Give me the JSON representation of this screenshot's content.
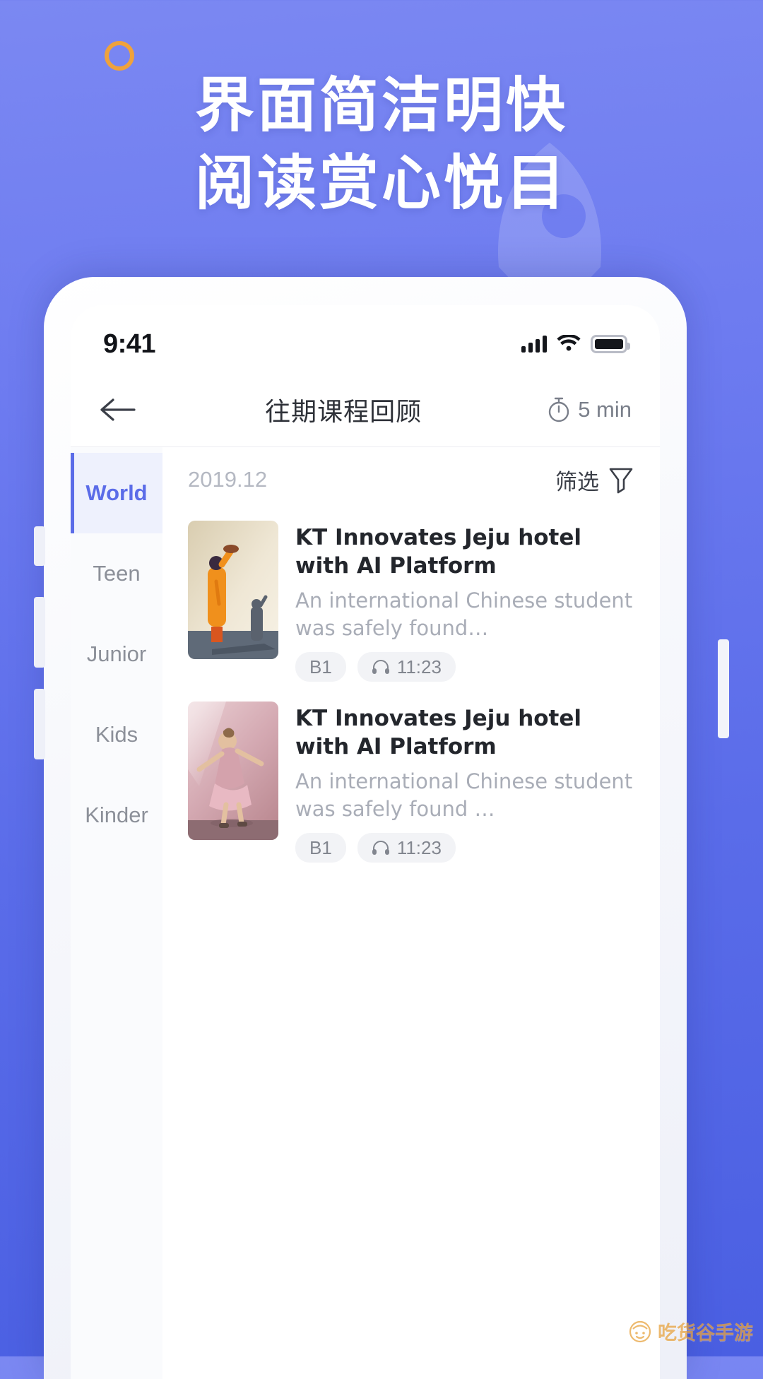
{
  "promo": {
    "headline_line1": "界面简洁明快",
    "headline_line2": "阅读赏心悦目",
    "ring_color": "#efa23c",
    "bg_top": "#7b88f2",
    "bg_bottom": "#4a5fe2"
  },
  "statusbar": {
    "time": "9:41",
    "signal_icon": "cellular-signal-icon",
    "wifi_icon": "wifi-icon",
    "battery_icon": "battery-full-icon"
  },
  "navbar": {
    "back_icon": "back-arrow-icon",
    "title": "往期课程回顾",
    "timer_icon": "stopwatch-icon",
    "duration": "5 min"
  },
  "sidebar": {
    "items": [
      {
        "label": "World",
        "active": true
      },
      {
        "label": "Teen",
        "active": false
      },
      {
        "label": "Junior",
        "active": false
      },
      {
        "label": "Kids",
        "active": false
      },
      {
        "label": "Kinder",
        "active": false
      }
    ],
    "active_color": "#5b6ce8"
  },
  "filter": {
    "date": "2019.12",
    "label": "筛选",
    "icon": "funnel-filter-icon"
  },
  "articles": [
    {
      "title": "KT Innovates Jeju hotel with AI Platform",
      "description": "An international Chinese student was safely found…",
      "level": "B1",
      "audio_icon": "headphones-icon",
      "duration": "11:23",
      "thumb": "man-waving-hat-illustration"
    },
    {
      "title": "KT Innovates Jeju hotel with AI Platform",
      "description": "An international Chinese student was safely found …",
      "level": "B1",
      "audio_icon": "headphones-icon",
      "duration": "11:23",
      "thumb": "girl-dancing-photo"
    }
  ],
  "watermark": {
    "text": "吃货谷手游",
    "icon": "smiley-face-icon"
  }
}
